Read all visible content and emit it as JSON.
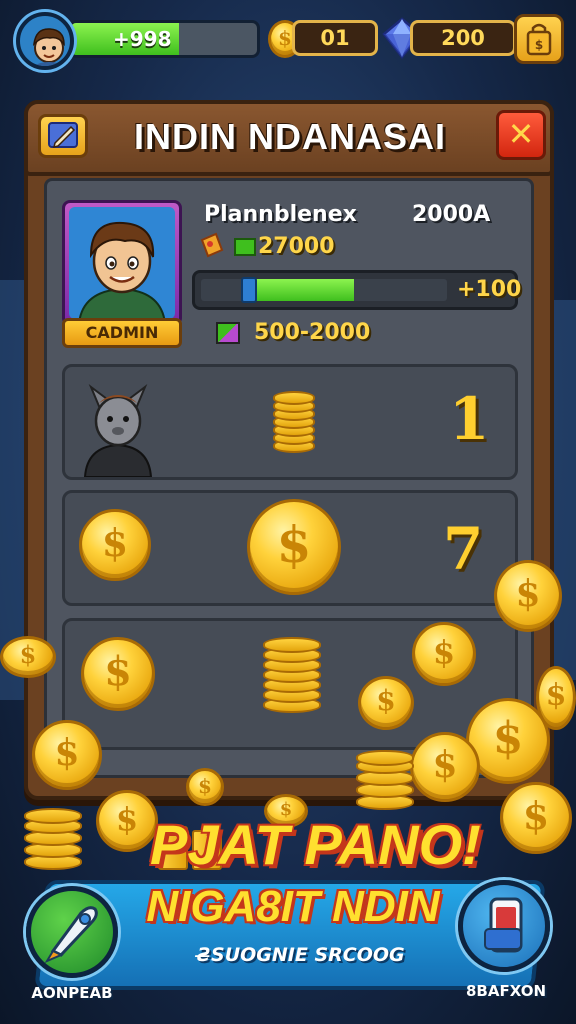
{
  "hud": {
    "xp_value": "+998",
    "xp_progress": 0.58,
    "coins": "01",
    "gems": "200",
    "player_icon": "player-avatar-icon",
    "coin_icon": "coin-icon",
    "gem_icon": "gem-icon",
    "shop_icon": "shop-bag-icon"
  },
  "panel": {
    "title": "INDIN NDANASAI",
    "edit_icon": "edit-pencil-icon",
    "close_icon": "close-icon",
    "close_label": "✕"
  },
  "profile": {
    "name": "Plannblenex",
    "score": "2000A",
    "cash": "27000",
    "badge": "CADMIN",
    "progress_bonus": "+100",
    "progress_value": 0.62,
    "range": "500-2000"
  },
  "rows": [
    {
      "num": "1",
      "icon": "character-portrait-icon"
    },
    {
      "num": "7",
      "icon": "coin-icon"
    },
    {
      "num": "",
      "icon": "coin-stack-icon"
    }
  ],
  "banner": {
    "title": "PJAT PANO!",
    "subtitle": "NIGA8IT NDIN",
    "tagline": "Ƨ̶SUOGNIE SRCOOG",
    "left_button_label": "AONPEAB",
    "right_button_label": "8BAFXON",
    "left_icon": "rocket-icon",
    "right_icon": "phone-card-icon"
  },
  "colors": {
    "accent_gold": "#ffd23b",
    "accent_green": "#5fd82e",
    "panel_wood": "#6b4121",
    "close_red": "#e3351a",
    "banner_blue": "#1f8fd6"
  }
}
